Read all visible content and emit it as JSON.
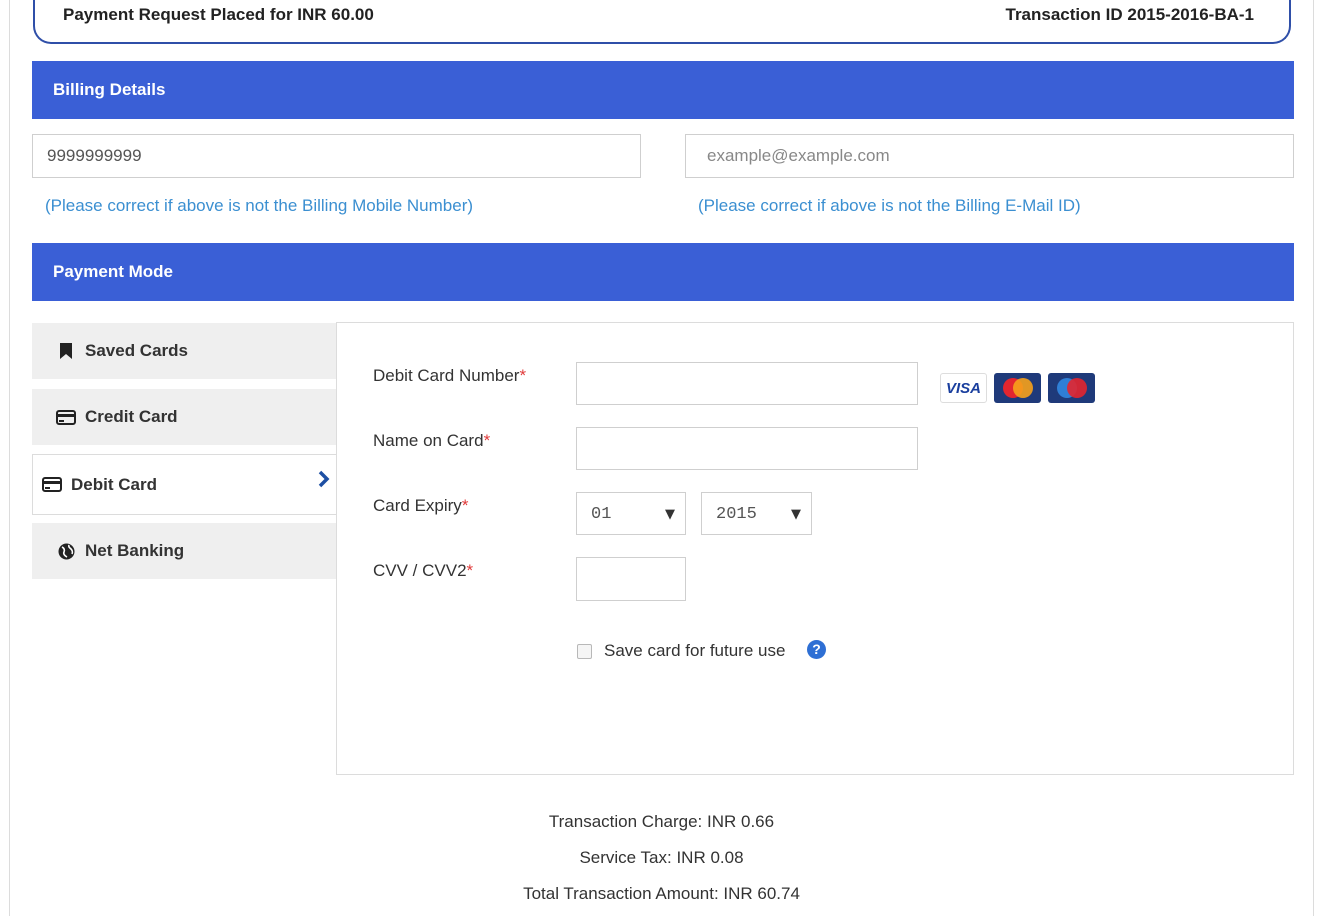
{
  "header": {
    "request_text": "Payment Request Placed for INR 60.00",
    "transaction_id_text": "Transaction ID 2015-2016-BA-1"
  },
  "billing": {
    "title": "Billing Details",
    "mobile_value": "9999999999",
    "email_placeholder": "example@example.com",
    "mobile_hint": "(Please correct if above is not the Billing Mobile Number)",
    "email_hint": "(Please correct if above is not the Billing E-Mail ID)"
  },
  "payment_mode": {
    "title": "Payment Mode",
    "tabs": [
      {
        "label": "Saved Cards",
        "icon": "bookmark-icon"
      },
      {
        "label": "Credit Card",
        "icon": "credit-card-icon"
      },
      {
        "label": "Debit Card",
        "icon": "credit-card-icon",
        "active": true
      },
      {
        "label": "Net Banking",
        "icon": "globe-icon"
      }
    ]
  },
  "debit_form": {
    "card_number_label": "Debit Card Number",
    "name_label": "Name on Card",
    "expiry_label": "Card Expiry",
    "cvv_label": "CVV / CVV2",
    "required_mark": "*",
    "expiry_month": "01",
    "expiry_year": "2015",
    "save_card_label": "Save card for future use",
    "card_logos": [
      "VISA",
      "MasterCard",
      "Maestro"
    ]
  },
  "totals": {
    "transaction_charge": "Transaction Charge: INR 0.66",
    "service_tax": "Service Tax: INR 0.08",
    "total_amount": "Total Transaction Amount: INR 60.74"
  },
  "colors": {
    "header_bar": "#3a5fd6",
    "hint_text": "#3b8fd1",
    "required": "#e03a3a",
    "chevron": "#1d4fa3"
  }
}
